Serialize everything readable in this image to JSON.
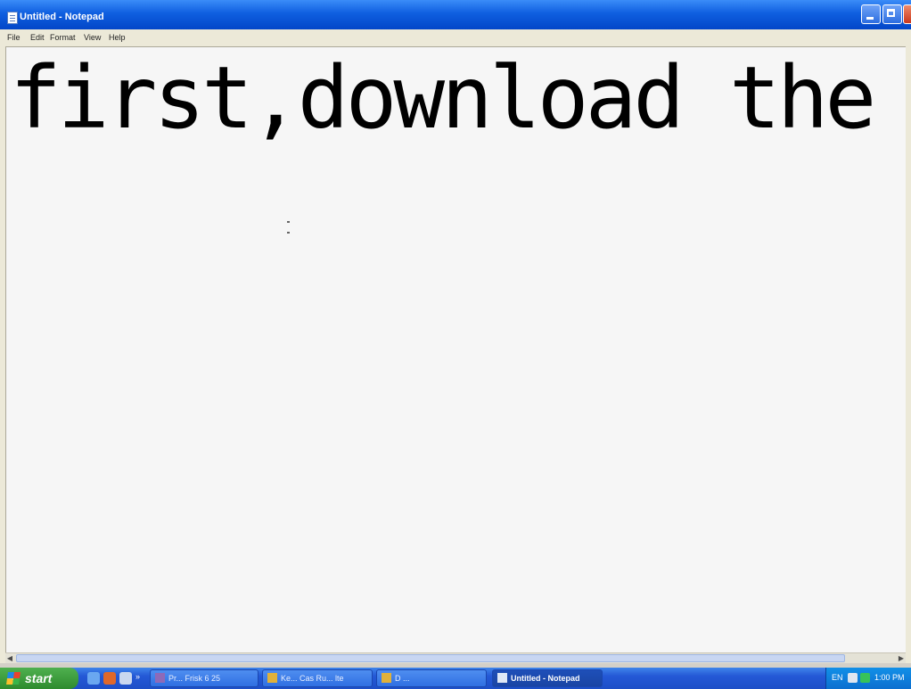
{
  "window": {
    "title": "Untitled - Notepad"
  },
  "menu": {
    "file": "File",
    "edit": "Edit",
    "format": "Format",
    "view": "View",
    "help": "Help"
  },
  "editor": {
    "text": "first,download the"
  },
  "taskbar": {
    "start_label": "start",
    "tasks": [
      {
        "label": "Pr... Frisk 6 25"
      },
      {
        "label": "Ke... Cas Ru... lte"
      },
      {
        "label": "D ..."
      },
      {
        "label": "Untitled - Notepad"
      }
    ],
    "tray_lang": "EN",
    "clock": "1:00 PM"
  },
  "colors": {
    "titlebar": "#0f5fe0",
    "taskbar": "#2458d6",
    "start_button": "#3a9b3a",
    "editor_bg": "#f6f6f6"
  },
  "icons": [
    "notepad-icon",
    "minimize-icon",
    "maximize-icon",
    "close-icon",
    "windows-flag-icon",
    "ie-icon",
    "media-player-icon",
    "folder-icon",
    "volume-icon",
    "network-icon"
  ]
}
